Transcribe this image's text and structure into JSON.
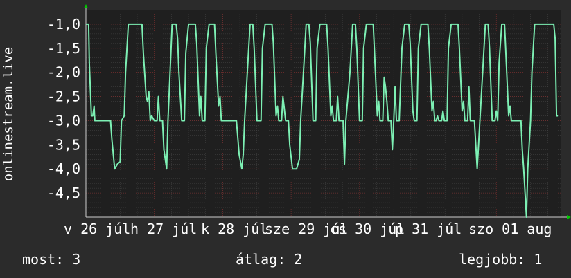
{
  "chart_data": {
    "type": "line",
    "ylabel": "onlinestream.live",
    "ylim": [
      -5.0,
      -0.7
    ],
    "y_ticks": [
      "-1,0",
      "-1,5",
      "-2,0",
      "-2,5",
      "-3,0",
      "-3,5",
      "-4,0",
      "-4,5"
    ],
    "x_ticks": [
      "v 26 júl",
      "h 27 júl",
      "k 28 júl",
      "sze 29 júl",
      "cs 30 júl",
      "p 31 júl",
      "szo 01 aug"
    ],
    "grid": true,
    "colors": {
      "background": "#2b2b2b",
      "plot": "#1f1f1f",
      "line": "#7df0b4",
      "grid_major": "#8a2f2f",
      "grid_minor": "#4a4a4a",
      "axis_arrow": "#00cc00"
    },
    "series": [
      {
        "values": [
          [
            0.0,
            -1.0
          ],
          [
            0.04,
            -1.0
          ],
          [
            0.05,
            -1.8
          ],
          [
            0.08,
            -2.9
          ],
          [
            0.1,
            -2.9
          ],
          [
            0.12,
            -2.7
          ],
          [
            0.13,
            -3.0
          ],
          [
            0.2,
            -3.0
          ],
          [
            0.28,
            -3.0
          ],
          [
            0.36,
            -3.0
          ],
          [
            0.38,
            -3.4
          ],
          [
            0.42,
            -4.0
          ],
          [
            0.46,
            -3.9
          ],
          [
            0.5,
            -3.85
          ],
          [
            0.52,
            -3.0
          ],
          [
            0.56,
            -2.9
          ],
          [
            0.58,
            -2.0
          ],
          [
            0.62,
            -1.0
          ],
          [
            0.72,
            -1.0
          ],
          [
            0.82,
            -1.0
          ],
          [
            0.84,
            -1.6
          ],
          [
            0.88,
            -2.5
          ],
          [
            0.9,
            -2.6
          ],
          [
            0.92,
            -2.4
          ],
          [
            0.94,
            -3.0
          ],
          [
            0.96,
            -2.9
          ],
          [
            1.0,
            -3.0
          ],
          [
            1.04,
            -3.0
          ],
          [
            1.06,
            -2.5
          ],
          [
            1.08,
            -3.0
          ],
          [
            1.12,
            -3.0
          ],
          [
            1.14,
            -3.6
          ],
          [
            1.18,
            -4.0
          ],
          [
            1.2,
            -3.0
          ],
          [
            1.26,
            -1.0
          ],
          [
            1.32,
            -1.0
          ],
          [
            1.34,
            -1.3
          ],
          [
            1.36,
            -2.0
          ],
          [
            1.4,
            -3.0
          ],
          [
            1.44,
            -3.0
          ],
          [
            1.46,
            -1.6
          ],
          [
            1.5,
            -1.0
          ],
          [
            1.6,
            -1.0
          ],
          [
            1.62,
            -1.4
          ],
          [
            1.66,
            -2.9
          ],
          [
            1.68,
            -2.5
          ],
          [
            1.7,
            -3.0
          ],
          [
            1.74,
            -3.0
          ],
          [
            1.76,
            -1.5
          ],
          [
            1.8,
            -1.0
          ],
          [
            1.88,
            -1.0
          ],
          [
            1.9,
            -1.6
          ],
          [
            1.94,
            -2.7
          ],
          [
            1.96,
            -2.5
          ],
          [
            1.98,
            -3.0
          ],
          [
            2.02,
            -3.0
          ],
          [
            2.2,
            -3.0
          ],
          [
            2.24,
            -3.7
          ],
          [
            2.28,
            -4.0
          ],
          [
            2.3,
            -3.7
          ],
          [
            2.32,
            -3.0
          ],
          [
            2.36,
            -2.0
          ],
          [
            2.4,
            -1.0
          ],
          [
            2.44,
            -1.0
          ],
          [
            2.46,
            -1.5
          ],
          [
            2.5,
            -3.0
          ],
          [
            2.56,
            -3.0
          ],
          [
            2.58,
            -1.5
          ],
          [
            2.62,
            -1.0
          ],
          [
            2.72,
            -1.0
          ],
          [
            2.74,
            -1.4
          ],
          [
            2.78,
            -2.9
          ],
          [
            2.8,
            -2.7
          ],
          [
            2.82,
            -3.0
          ],
          [
            2.86,
            -3.0
          ],
          [
            2.88,
            -2.5
          ],
          [
            2.92,
            -3.0
          ],
          [
            2.96,
            -3.0
          ],
          [
            2.98,
            -3.5
          ],
          [
            3.02,
            -4.0
          ],
          [
            3.08,
            -4.0
          ],
          [
            3.12,
            -3.8
          ],
          [
            3.14,
            -3.0
          ],
          [
            3.18,
            -2.0
          ],
          [
            3.22,
            -1.0
          ],
          [
            3.26,
            -1.0
          ],
          [
            3.28,
            -1.4
          ],
          [
            3.32,
            -3.0
          ],
          [
            3.36,
            -3.0
          ],
          [
            3.38,
            -1.5
          ],
          [
            3.42,
            -1.0
          ],
          [
            3.52,
            -1.0
          ],
          [
            3.54,
            -1.5
          ],
          [
            3.58,
            -2.9
          ],
          [
            3.6,
            -2.7
          ],
          [
            3.62,
            -3.0
          ],
          [
            3.66,
            -3.0
          ],
          [
            3.68,
            -2.5
          ],
          [
            3.7,
            -3.0
          ],
          [
            3.76,
            -3.0
          ],
          [
            3.78,
            -3.9
          ],
          [
            3.8,
            -3.0
          ],
          [
            3.86,
            -2.0
          ],
          [
            3.9,
            -1.0
          ],
          [
            3.94,
            -1.0
          ],
          [
            3.96,
            -1.5
          ],
          [
            4.0,
            -3.0
          ],
          [
            4.04,
            -3.0
          ],
          [
            4.06,
            -1.5
          ],
          [
            4.1,
            -1.0
          ],
          [
            4.2,
            -1.0
          ],
          [
            4.22,
            -1.6
          ],
          [
            4.26,
            -2.9
          ],
          [
            4.28,
            -2.6
          ],
          [
            4.3,
            -3.0
          ],
          [
            4.34,
            -3.0
          ],
          [
            4.36,
            -2.1
          ],
          [
            4.38,
            -2.3
          ],
          [
            4.4,
            -2.6
          ],
          [
            4.42,
            -3.0
          ],
          [
            4.46,
            -3.0
          ],
          [
            4.48,
            -3.6
          ],
          [
            4.5,
            -3.0
          ],
          [
            4.52,
            -2.3
          ],
          [
            4.54,
            -3.0
          ],
          [
            4.58,
            -3.0
          ],
          [
            4.62,
            -1.5
          ],
          [
            4.66,
            -1.0
          ],
          [
            4.72,
            -1.0
          ],
          [
            4.74,
            -1.4
          ],
          [
            4.78,
            -2.8
          ],
          [
            4.8,
            -3.0
          ],
          [
            4.84,
            -3.0
          ],
          [
            4.86,
            -1.5
          ],
          [
            4.9,
            -1.0
          ],
          [
            5.0,
            -1.0
          ],
          [
            5.02,
            -1.5
          ],
          [
            5.06,
            -2.8
          ],
          [
            5.08,
            -2.6
          ],
          [
            5.1,
            -3.0
          ],
          [
            5.12,
            -3.0
          ],
          [
            5.14,
            -2.9
          ],
          [
            5.16,
            -3.0
          ],
          [
            5.2,
            -3.0
          ],
          [
            5.22,
            -2.8
          ],
          [
            5.24,
            -3.0
          ],
          [
            5.28,
            -3.0
          ],
          [
            5.3,
            -1.5
          ],
          [
            5.34,
            -1.0
          ],
          [
            5.44,
            -1.0
          ],
          [
            5.46,
            -1.5
          ],
          [
            5.5,
            -2.8
          ],
          [
            5.52,
            -2.6
          ],
          [
            5.54,
            -3.0
          ],
          [
            5.58,
            -3.0
          ],
          [
            5.6,
            -2.3
          ],
          [
            5.62,
            -3.0
          ],
          [
            5.68,
            -3.0
          ],
          [
            5.7,
            -3.5
          ],
          [
            5.72,
            -4.0
          ],
          [
            5.74,
            -3.5
          ],
          [
            5.76,
            -3.0
          ],
          [
            5.8,
            -2.0
          ],
          [
            5.84,
            -1.0
          ],
          [
            5.88,
            -1.0
          ],
          [
            5.9,
            -1.5
          ],
          [
            5.94,
            -3.0
          ],
          [
            5.98,
            -3.0
          ],
          [
            6.0,
            -2.8
          ],
          [
            6.02,
            -3.0
          ],
          [
            6.04,
            -1.8
          ],
          [
            6.08,
            -1.0
          ],
          [
            6.12,
            -1.0
          ],
          [
            6.14,
            -1.6
          ],
          [
            6.18,
            -2.9
          ],
          [
            6.2,
            -2.7
          ],
          [
            6.22,
            -3.0
          ],
          [
            6.26,
            -3.0
          ],
          [
            6.28,
            -3.0
          ],
          [
            6.3,
            -3.0
          ],
          [
            6.32,
            -3.0
          ],
          [
            6.36,
            -3.0
          ],
          [
            6.38,
            -3.6
          ],
          [
            6.4,
            -4.0
          ],
          [
            6.44,
            -5.0
          ],
          [
            6.46,
            -4.0
          ],
          [
            6.5,
            -3.0
          ],
          [
            6.52,
            -2.0
          ],
          [
            6.56,
            -1.0
          ],
          [
            6.84,
            -1.0
          ],
          [
            6.86,
            -1.3
          ],
          [
            6.88,
            -2.9
          ],
          [
            6.9,
            -2.9
          ]
        ]
      }
    ]
  },
  "footer": {
    "now": "most: 3",
    "avg": "átlag: 2",
    "best": "legjobb: 1"
  }
}
